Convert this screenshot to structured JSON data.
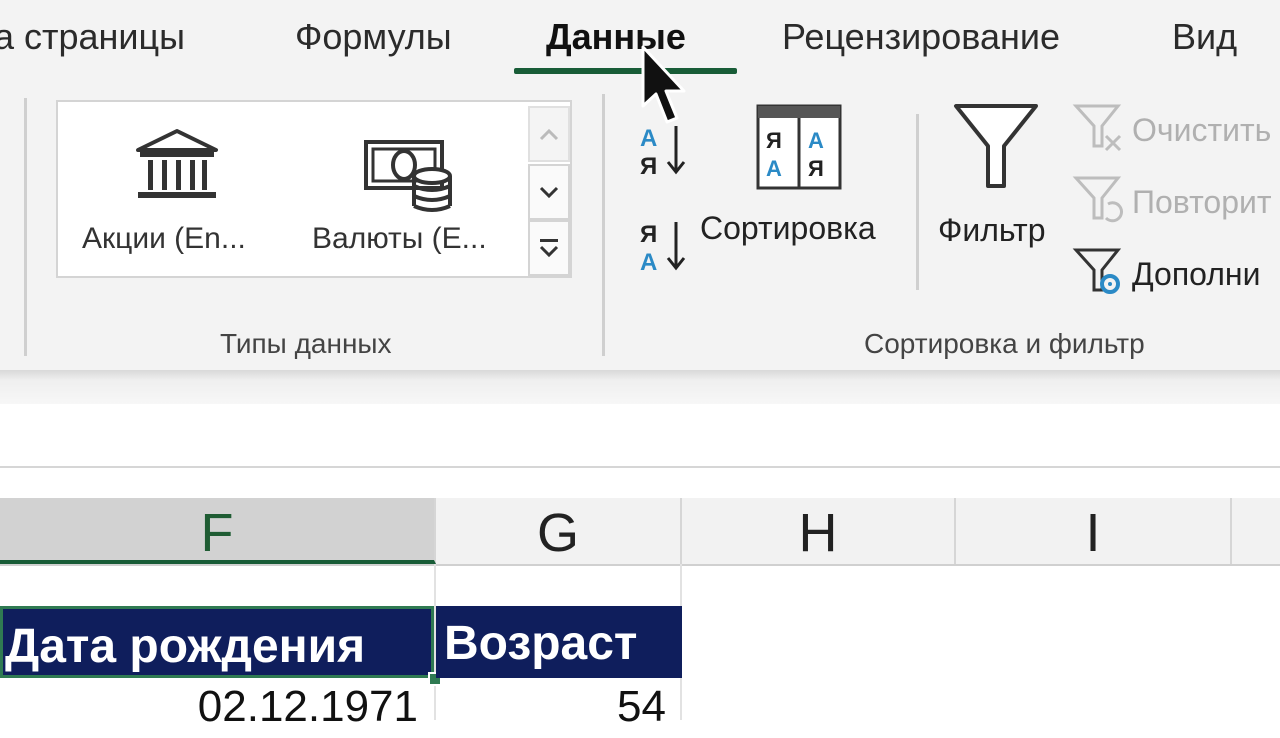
{
  "tabs": [
    {
      "label": "а страницы"
    },
    {
      "label": "Формулы"
    },
    {
      "label": "Данные",
      "active": true
    },
    {
      "label": "Рецензирование"
    },
    {
      "label": "Вид"
    }
  ],
  "data_types": {
    "stocks_label": "Акции (En...",
    "currencies_label": "Валюты (E...",
    "group_label": "Типы данных"
  },
  "sort_filter": {
    "sort_az_icon": "sort-a-to-z-icon",
    "sort_za_icon": "sort-z-to-a-icon",
    "sort_label": "Сортировка",
    "filter_label": "Фильтр",
    "clear_label": "Очистить",
    "reapply_label": "Повторит",
    "advanced_label": "Дополни",
    "group_label": "Сортировка и фильтр"
  },
  "columns": [
    "F",
    "G",
    "H",
    "I"
  ],
  "table": {
    "headers": [
      "Дата рождения",
      "Возраст"
    ],
    "row1": [
      "02.12.1971",
      "54"
    ]
  },
  "colors": {
    "accent": "#185c37",
    "header_fill": "#0f1e5c",
    "selected_col": "#d2d2d2"
  }
}
